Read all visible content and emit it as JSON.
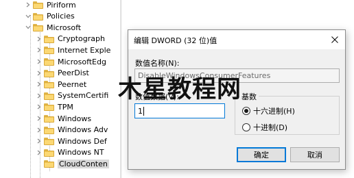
{
  "tree": {
    "nodes": [
      {
        "label": "Piriform",
        "expanded": false
      },
      {
        "label": "Policies",
        "expanded": true
      },
      {
        "label": "Microsoft",
        "expanded": true
      },
      {
        "label": "Cryptograph",
        "expanded": false
      },
      {
        "label": "Internet Exple",
        "expanded": false
      },
      {
        "label": "MicrosoftEdg",
        "expanded": false
      },
      {
        "label": "PeerDist",
        "expanded": false
      },
      {
        "label": "Peernet",
        "expanded": false
      },
      {
        "label": "SystemCertifi",
        "expanded": false
      },
      {
        "label": "TPM",
        "expanded": false
      },
      {
        "label": "Windows",
        "expanded": false
      },
      {
        "label": "Windows Adv",
        "expanded": false
      },
      {
        "label": "Windows Def",
        "expanded": false
      },
      {
        "label": "Windows NT",
        "expanded": false
      },
      {
        "label": "CloudConten",
        "expanded": false,
        "selected": true
      }
    ]
  },
  "dialog": {
    "title": "编辑 DWORD (32 位)值",
    "value_name_label": "数值名称(N):",
    "value_name": "DisableWindowsConsumerFeatures",
    "value_data_label": "数值数据(V):",
    "value_data": "1",
    "base_group_label": "基数",
    "radix_options": [
      {
        "label": "十六进制(H)",
        "selected": true
      },
      {
        "label": "十进制(D)",
        "selected": false
      }
    ],
    "ok_label": "确定",
    "cancel_label": "取消"
  },
  "watermark": {
    "text": "木星教程网"
  },
  "colors": {
    "folder": "#f3c95a",
    "accent": "#0078d7",
    "dialog_bg": "#f0f0f0"
  }
}
